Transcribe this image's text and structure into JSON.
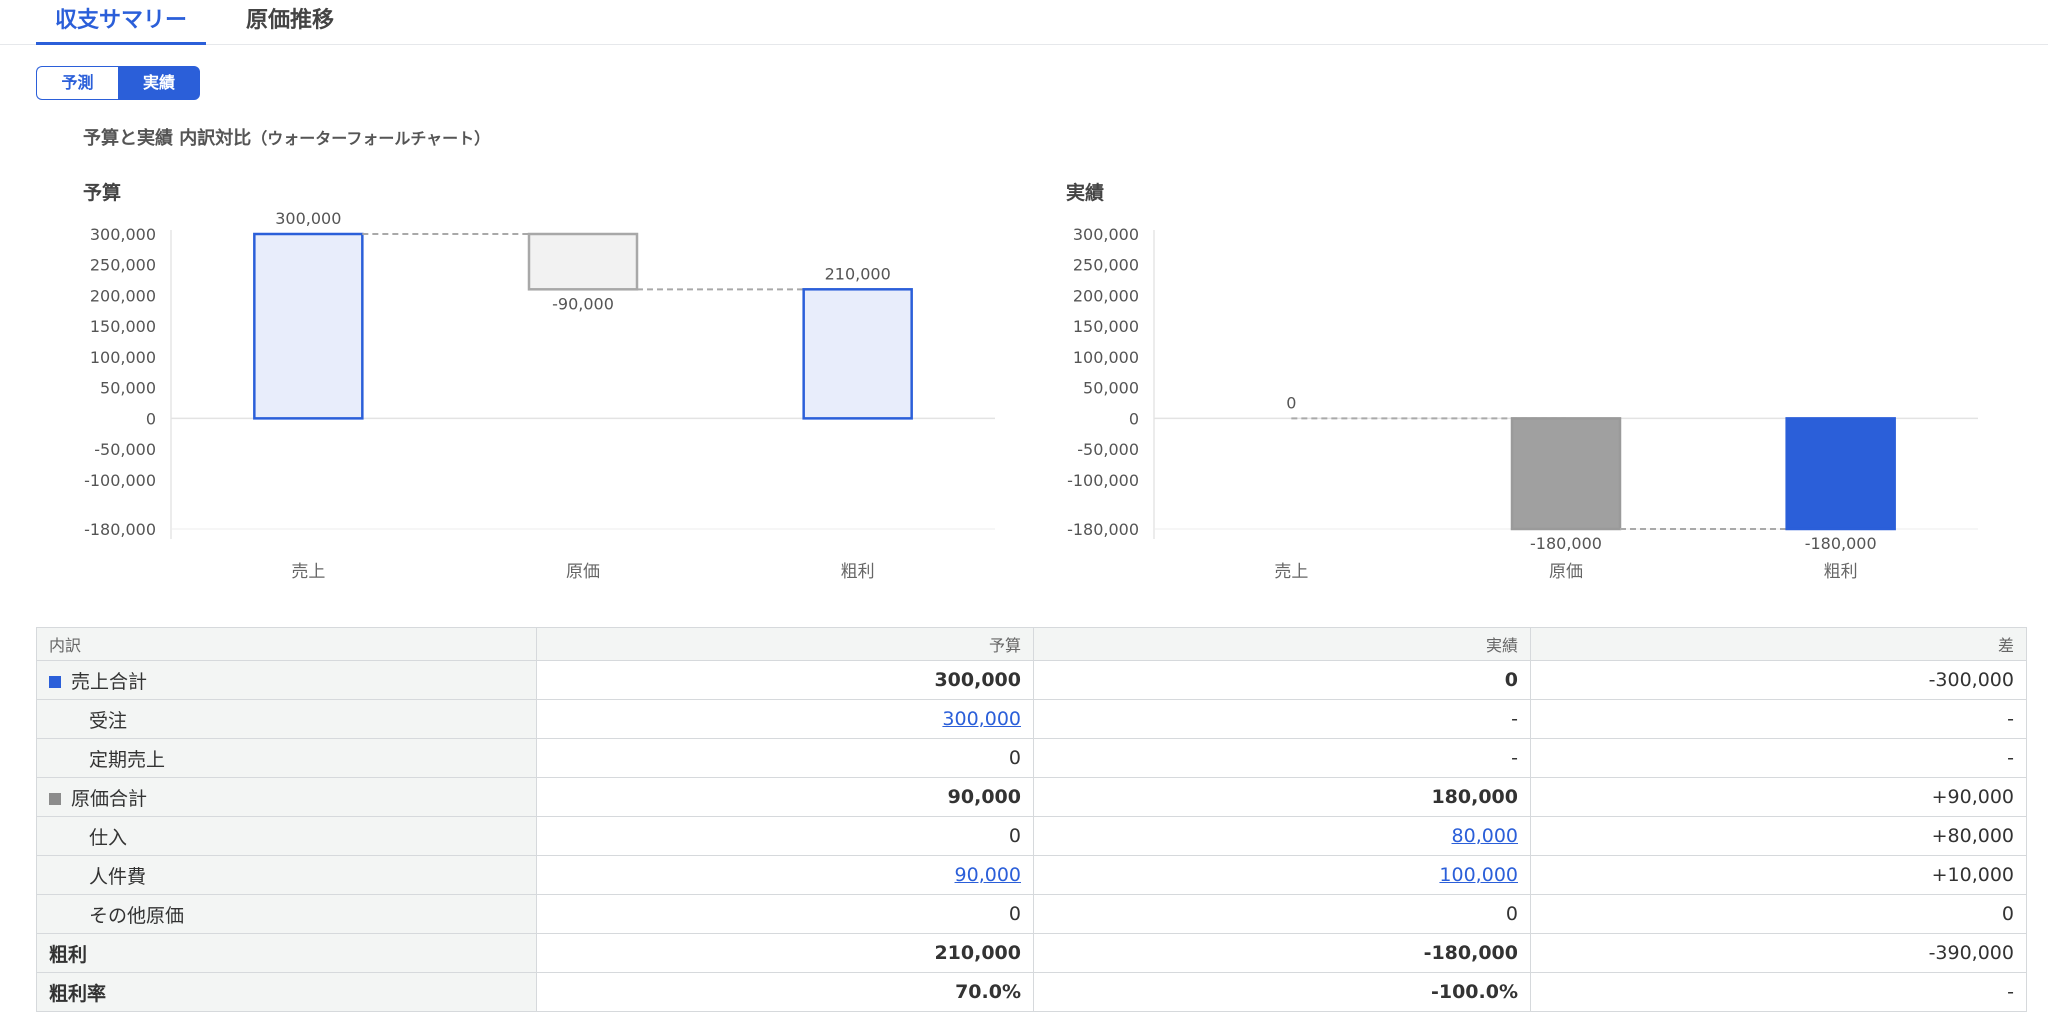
{
  "tabs": [
    {
      "label": "収支サマリー"
    },
    {
      "label": "原価推移"
    }
  ],
  "toggle": {
    "forecast_label": "予測",
    "actual_label": "実績",
    "selected": "実績"
  },
  "chart_header": {
    "title": "予算と実績 内訳対比",
    "note": "（ウォーターフォールチャート）"
  },
  "colors": {
    "accent": "#2b5fd9",
    "budget_bar": "#e8edfb",
    "cost_bar_budget": "#f2f2f2",
    "cost_bar_actual": "#a0a0a0",
    "profit_bar_actual": "#2b5fd9"
  },
  "chart_data": [
    {
      "type": "bar",
      "title": "予算",
      "categories": [
        "売上",
        "原価",
        "粗利"
      ],
      "values": [
        300000,
        -90000,
        210000
      ],
      "value_labels": [
        "300,000",
        "-90,000",
        "210,000"
      ],
      "y_ticks": [
        {
          "value": 300000,
          "label": "300,000"
        },
        {
          "value": 250000,
          "label": "250,000"
        },
        {
          "value": 200000,
          "label": "200,000"
        },
        {
          "value": 150000,
          "label": "150,000"
        },
        {
          "value": 100000,
          "label": "100,000"
        },
        {
          "value": 50000,
          "label": "50,000"
        },
        {
          "value": 0,
          "label": "0"
        },
        {
          "value": -50000,
          "label": "-50,000"
        },
        {
          "value": -100000,
          "label": "-100,000"
        },
        {
          "value": -180000,
          "label": "-180,000"
        }
      ],
      "ylim": [
        -180000,
        300000
      ]
    },
    {
      "type": "bar",
      "title": "実績",
      "categories": [
        "売上",
        "原価",
        "粗利"
      ],
      "values": [
        0,
        -180000,
        -180000
      ],
      "value_labels": [
        "0",
        "-180,000",
        "-180,000"
      ],
      "y_ticks": [
        {
          "value": 300000,
          "label": "300,000"
        },
        {
          "value": 250000,
          "label": "250,000"
        },
        {
          "value": 200000,
          "label": "200,000"
        },
        {
          "value": 150000,
          "label": "150,000"
        },
        {
          "value": 100000,
          "label": "100,000"
        },
        {
          "value": 50000,
          "label": "50,000"
        },
        {
          "value": 0,
          "label": "0"
        },
        {
          "value": -50000,
          "label": "-50,000"
        },
        {
          "value": -100000,
          "label": "-100,000"
        },
        {
          "value": -180000,
          "label": "-180,000"
        }
      ],
      "ylim": [
        -180000,
        300000
      ]
    }
  ],
  "table": {
    "headers": [
      "内訳",
      "予算",
      "実績",
      "差"
    ],
    "rows": [
      {
        "label": "売上合計",
        "budget": "300,000",
        "actual": "0",
        "diff": "-300,000",
        "kind": "total-sales"
      },
      {
        "label": "受注",
        "budget": "300,000",
        "actual": "-",
        "diff": "-",
        "kind": "child",
        "budget_link": true
      },
      {
        "label": "定期売上",
        "budget": "0",
        "actual": "-",
        "diff": "-",
        "kind": "child"
      },
      {
        "label": "原価合計",
        "budget": "90,000",
        "actual": "180,000",
        "diff": "+90,000",
        "kind": "total-cost"
      },
      {
        "label": "仕入",
        "budget": "0",
        "actual": "80,000",
        "diff": "+80,000",
        "kind": "child",
        "actual_link": true
      },
      {
        "label": "人件費",
        "budget": "90,000",
        "actual": "100,000",
        "diff": "+10,000",
        "kind": "child",
        "budget_link": true,
        "actual_link": true
      },
      {
        "label": "その他原価",
        "budget": "0",
        "actual": "0",
        "diff": "0",
        "kind": "child"
      },
      {
        "label": "粗利",
        "budget": "210,000",
        "actual": "-180,000",
        "diff": "-390,000",
        "kind": "profit"
      },
      {
        "label": "粗利率",
        "budget": "70.0%",
        "actual": "-100.0%",
        "diff": "-",
        "kind": "profit"
      }
    ]
  }
}
